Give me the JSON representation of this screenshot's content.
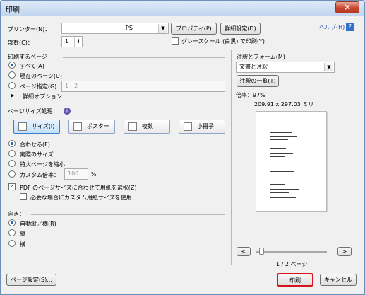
{
  "window": {
    "title": "印刷",
    "close_symbol": "×"
  },
  "header": {
    "printer_label": "プリンター(N)：",
    "printer_value": "PS",
    "properties_button": "プロパティ(P)",
    "advanced_button": "詳細設定(D)",
    "help_link": "ヘルプ(H)",
    "copies_label": "部数(C)：",
    "copies_value": "1",
    "grayscale_label": "グレースケール (白黒) で印刷(Y)"
  },
  "pages": {
    "section_label": "印刷するページ",
    "all": "すべて(A)",
    "current": "現在のページ(U)",
    "range": "ページ指定(G)",
    "range_value": "1 - 2",
    "more_options": "詳細オプション"
  },
  "page_sizing": {
    "section_label": "ページサイズ処理",
    "info_icon_symbol": "i",
    "buttons": {
      "size": "サイズ(I)",
      "poster": "ポスター",
      "multiple": "複数",
      "booklet": "小冊子"
    },
    "fit": "合わせる(F)",
    "actual_size": "実際のサイズ",
    "shrink": "特大ページを縮小",
    "custom_scale": "カスタム倍率：",
    "custom_scale_value": "100",
    "percent": "%",
    "paper_source_checkbox": "PDF のページサイズに合わせて用紙を選択(Z)",
    "custom_paper_checkbox": "必要な場合にカスタム用紙サイズを使用"
  },
  "orientation": {
    "section_label": "向き：",
    "auto": "自動縦／横(R)",
    "portrait": "縦",
    "landscape": "横"
  },
  "comments_forms": {
    "section_label": "注釈とフォーム(M)",
    "selected": "文書と注釈",
    "summary_button": "注釈の一覧(T)"
  },
  "preview": {
    "scale": "倍率：97%",
    "dimensions": "209.91 x 297.03 ミリ",
    "page_count": "1 / 2 ページ",
    "prev_symbol": "<",
    "next_symbol": ">"
  },
  "footer": {
    "page_setup_button": "ページ設定(S)...",
    "print_button": "印刷",
    "cancel_button": "キャンセル"
  },
  "icons": {
    "dropdown": "▼",
    "stepper": "⬍",
    "triangle": "▶",
    "check": "✓"
  }
}
